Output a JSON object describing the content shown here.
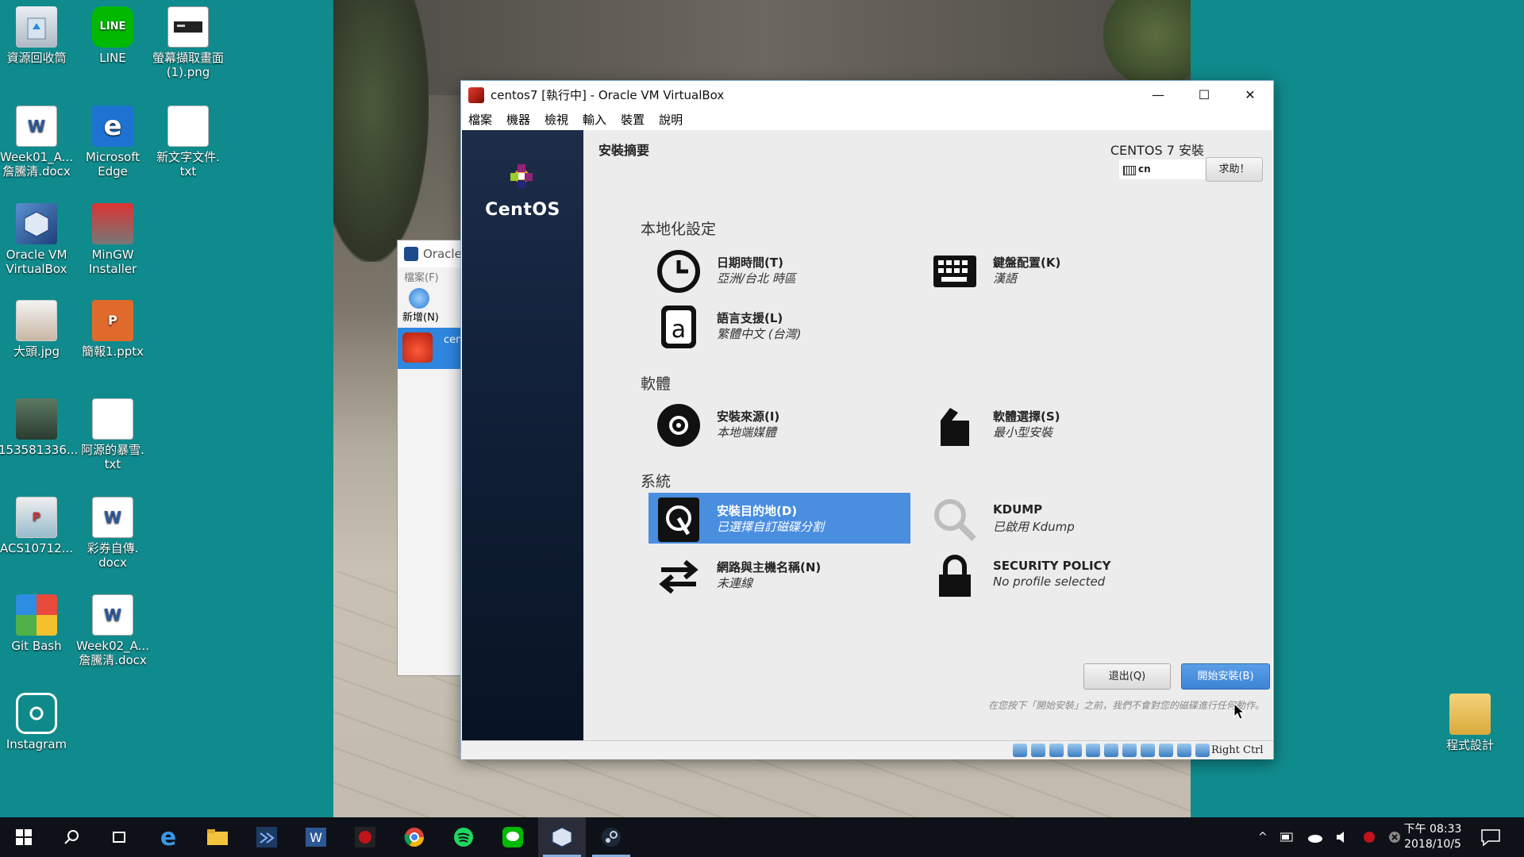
{
  "desktop_icons": [
    {
      "id": "recycle",
      "label": "資源回收筒",
      "icon": "recycle-bin-icon"
    },
    {
      "id": "line",
      "label": "LINE",
      "icon": "line-icon"
    },
    {
      "id": "screenshot",
      "label": "螢幕擷取畫面\n(1).png",
      "icon": "image-file-icon"
    },
    {
      "id": "week01",
      "label": "Week01_A...\n詹騰清.docx",
      "icon": "word-doc-icon"
    },
    {
      "id": "edge",
      "label": "Microsoft\nEdge",
      "icon": "edge-icon"
    },
    {
      "id": "newtxt",
      "label": "新文字文件.\ntxt",
      "icon": "text-file-icon"
    },
    {
      "id": "oraclevm",
      "label": "Oracle VM\nVirtualBox",
      "icon": "virtualbox-icon"
    },
    {
      "id": "mingw",
      "label": "MinGW\nInstaller",
      "icon": "mingw-icon"
    },
    {
      "id": "bigheadjpg",
      "label": "大頭.jpg",
      "icon": "photo-icon"
    },
    {
      "id": "pptx",
      "label": "簡報1.pptx",
      "icon": "powerpoint-icon"
    },
    {
      "id": "img1535",
      "label": "153581336...",
      "icon": "photo-icon"
    },
    {
      "id": "ayuan",
      "label": "阿源的暴雪.\ntxt",
      "icon": "text-file-icon"
    },
    {
      "id": "acs",
      "label": "ACS10712...",
      "icon": "powerpoint-icon"
    },
    {
      "id": "lottery",
      "label": "彩券自傳.\ndocx",
      "icon": "word-doc-icon"
    },
    {
      "id": "gitbash",
      "label": "Git Bash",
      "icon": "git-bash-icon"
    },
    {
      "id": "week02",
      "label": "Week02_A...\n詹騰清.docx",
      "icon": "word-doc-icon"
    },
    {
      "id": "instagram",
      "label": "Instagram",
      "icon": "instagram-icon"
    },
    {
      "id": "progdesign",
      "label": "程式設計",
      "icon": "folder-icon"
    }
  ],
  "bg_manager": {
    "title": "Oracle",
    "menu": "檔案(F)",
    "new_label": "新增(N)",
    "vm_short": "cen"
  },
  "window": {
    "title": "centos7 [執行中] - Oracle VM VirtualBox",
    "menu": [
      "檔案",
      "機器",
      "檢視",
      "輸入",
      "裝置",
      "說明"
    ],
    "controls": {
      "minimize": "—",
      "maximize": "☐",
      "close": "✕"
    }
  },
  "installer": {
    "brand": "CentOS",
    "page_title": "安裝摘要",
    "product": "CENTOS 7 安裝",
    "keyboard_layout": "cn",
    "help_button": "求助！",
    "sections": {
      "localization": "本地化設定",
      "software": "軟體",
      "system": "系統"
    },
    "spokes": {
      "datetime": {
        "name": "日期時間(T)",
        "status": "亞洲/台北 時區",
        "icon": "clock-icon"
      },
      "keyboard": {
        "name": "鍵盤配置(K)",
        "status": "漢語",
        "icon": "keyboard-icon"
      },
      "language": {
        "name": "語言支援(L)",
        "status": "繁體中文 (台灣)",
        "icon": "language-icon"
      },
      "source": {
        "name": "安裝來源(I)",
        "status": "本地端媒體",
        "icon": "disc-icon"
      },
      "software": {
        "name": "軟體選擇(S)",
        "status": "最小型安裝",
        "icon": "package-icon"
      },
      "destination": {
        "name": "安裝目的地(D)",
        "status": "已選擇自訂磁碟分割",
        "icon": "hard-disk-icon"
      },
      "kdump": {
        "name": "KDUMP",
        "status": "已啟用 Kdump",
        "icon": "search-icon"
      },
      "network": {
        "name": "網路與主機名稱(N)",
        "status": "未連線",
        "icon": "network-arrows-icon"
      },
      "security": {
        "name": "SECURITY POLICY",
        "status": "No profile selected",
        "icon": "lock-icon"
      }
    },
    "quit_button": "退出(Q)",
    "begin_button": "開始安裝(B)",
    "warning": "在您按下「開始安裝」之前，我們不會對您的磁碟進行任何動作。"
  },
  "statusbar": {
    "host_key": "Right Ctrl"
  },
  "taskbar": {
    "apps": [
      "start-icon",
      "search-icon",
      "task-view-icon",
      "edge-icon",
      "file-explorer-icon",
      "visual-studio-icon",
      "word-icon",
      "asus-icon",
      "chrome-icon",
      "spotify-icon",
      "line-icon",
      "virtualbox-icon",
      "steam-icon"
    ],
    "clock_time": "下午 08:33",
    "clock_date": "2018/10/5"
  },
  "colors": {
    "desktop": "#108b8d",
    "accent": "#4a8ee0",
    "sidebar": "#12213a",
    "taskbar": "#0f1119"
  }
}
